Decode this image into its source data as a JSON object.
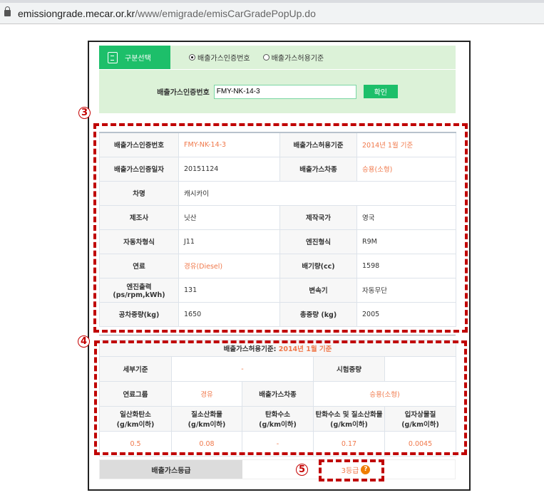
{
  "browser": {
    "url_host": "emissiongrade.mecar.or.kr",
    "url_path": "/www/emigrade/emisCarGradePopUp.do"
  },
  "search": {
    "tab_label": "구분선택",
    "radio_options": [
      {
        "label": "배출가스인증번호",
        "selected": true
      },
      {
        "label": "배출가스허용기준",
        "selected": false
      }
    ],
    "field_label": "배출가스인증번호",
    "field_value": "FMY-NK-14-3",
    "confirm_label": "확인"
  },
  "annotations": {
    "n3": "3",
    "n4": "4",
    "n5": "5"
  },
  "info": {
    "rows": [
      [
        "배출가스인증번호",
        "FMY-NK-14-3",
        "배출가스허용기준",
        "2014년 1월 기준"
      ],
      [
        "배출가스인증일자",
        "20151124",
        "배출가스차종",
        "승용(소형)"
      ],
      [
        "차명",
        "캐시카이"
      ],
      [
        "제조사",
        "닛산",
        "제작국가",
        "영국"
      ],
      [
        "자동차형식",
        "J11",
        "엔진형식",
        "R9M"
      ],
      [
        "연료",
        "경유(Diesel)",
        "배기량(cc)",
        "1598"
      ],
      [
        "엔진출력(ps/rpm,kWh)",
        "131",
        "변속기",
        "자동무단"
      ],
      [
        "공차중량(kg)",
        "1650",
        "총중량 (kg)",
        "2005"
      ]
    ]
  },
  "standard": {
    "title_label": "배출가스허용기준:",
    "title_value": "2014년 1월 기준",
    "detail_label": "세부기준",
    "detail_value": "-",
    "test_weight_label": "시험중량",
    "test_weight_value": "",
    "fuel_group_label": "연료그룹",
    "fuel_group_value": "경유",
    "vehicle_type_label": "배출가스차종",
    "vehicle_type_value": "승용(소형)",
    "pollutants": [
      {
        "name": "일산화탄소",
        "unit": "(g/km이하)",
        "value": "0.5"
      },
      {
        "name": "질소산화물",
        "unit": "(g/km이하)",
        "value": "0.08"
      },
      {
        "name": "탄화수소",
        "unit": "(g/km이하)",
        "value": "-"
      },
      {
        "name": "탄화수소 및 질소산화물",
        "unit": "(g/km이하)",
        "value": "0.17"
      },
      {
        "name": "입자상물질",
        "unit": "(g/km이하)",
        "value": "0.0045"
      }
    ]
  },
  "grade": {
    "label": "배출가스등급",
    "value": "3등급",
    "help": "?"
  }
}
